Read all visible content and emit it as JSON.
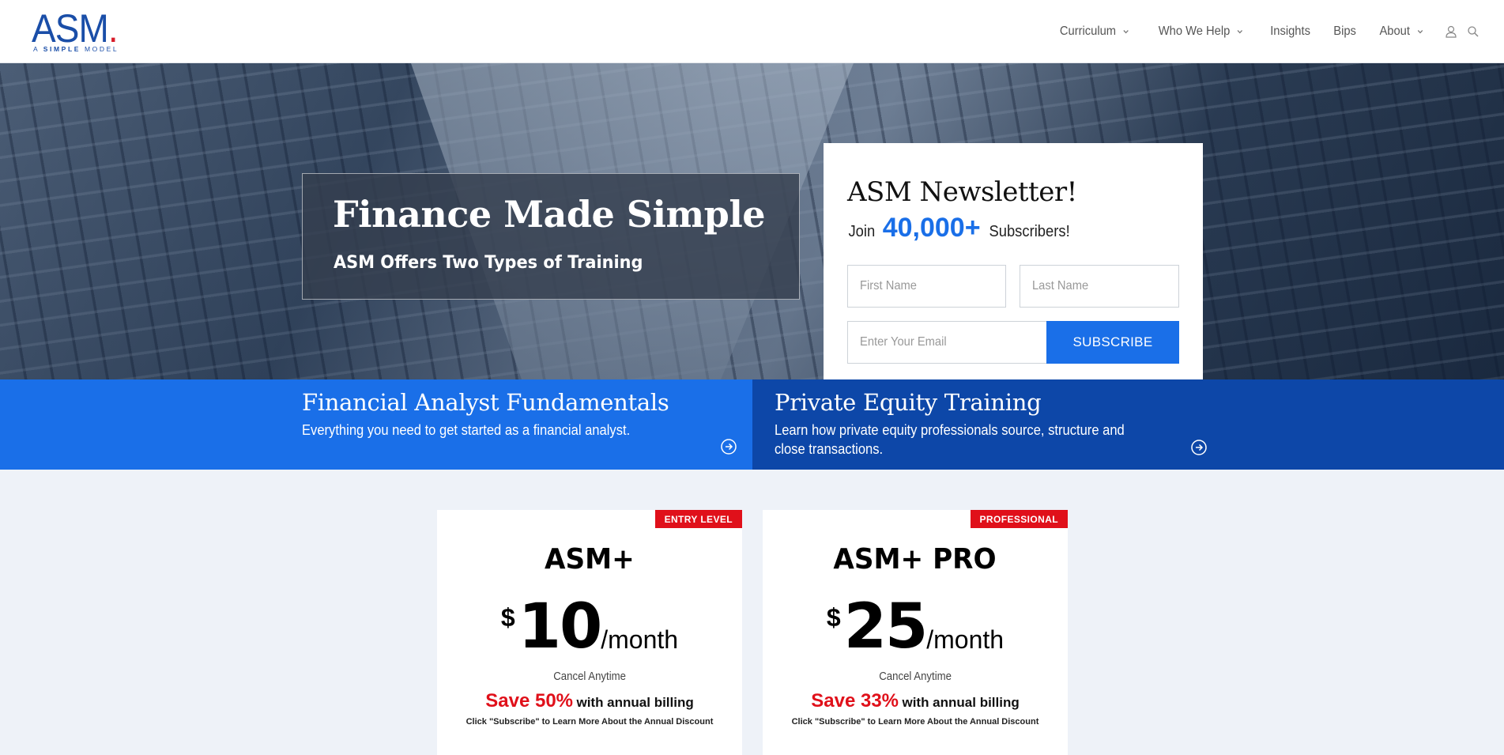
{
  "brand": {
    "name": "ASM",
    "dot": ".",
    "tagline_prefix": "A ",
    "tagline_bold": "SIMPLE",
    "tagline_suffix": " MODEL",
    "colors": {
      "primary": "#1a4ea8",
      "accent": "#d81d2a"
    }
  },
  "nav": {
    "items": [
      {
        "label": "Curriculum",
        "dropdown": true
      },
      {
        "label": "Who We Help",
        "dropdown": true
      },
      {
        "label": "Insights",
        "dropdown": false
      },
      {
        "label": "Bips",
        "dropdown": false
      },
      {
        "label": "About",
        "dropdown": true
      }
    ],
    "icons": [
      "user-icon",
      "search-icon"
    ]
  },
  "hero": {
    "title": "Finance Made Simple",
    "subtitle": "ASM Offers Two Types of Training"
  },
  "newsletter": {
    "title": "ASM Newsletter!",
    "join_prefix": "Join",
    "subscriber_count": "40,000+",
    "join_suffix": "Subscribers!",
    "first_name_placeholder": "First Name",
    "last_name_placeholder": "Last Name",
    "email_placeholder": "Enter Your Email",
    "subscribe_label": "SUBSCRIBE"
  },
  "training": [
    {
      "title": "Financial Analyst Fundamentals",
      "description": "Everything you need to get started as a financial analyst.",
      "color": "#1a6fe8"
    },
    {
      "title": "Private Equity Training",
      "description_line1": "Learn how private equity professionals source, structure and",
      "description_line2": "close transactions.",
      "color": "#0d47a8"
    }
  ],
  "plans": [
    {
      "badge": "ENTRY LEVEL",
      "name": "ASM+",
      "currency": "$",
      "amount": "10",
      "period": "/month",
      "cancel": "Cancel Anytime",
      "save": "Save 50%",
      "save_suffix": "with annual billing",
      "note": "Click \"Subscribe\" to Learn More About the Annual Discount"
    },
    {
      "badge": "PROFESSIONAL",
      "name": "ASM+ PRO",
      "currency": "$",
      "amount": "25",
      "period": "/month",
      "cancel": "Cancel Anytime",
      "save": "Save 33%",
      "save_suffix": "with annual billing",
      "note": "Click \"Subscribe\" to Learn More About the Annual Discount"
    }
  ]
}
